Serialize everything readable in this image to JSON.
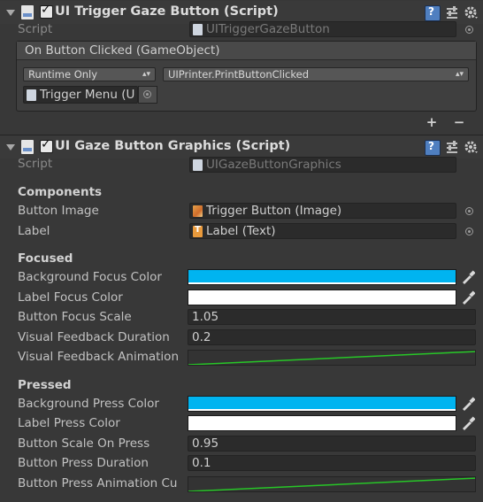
{
  "trigger_component": {
    "title": "UI Trigger Gaze Button (Script)",
    "script_label": "Script",
    "script_value": "UITriggerGazeButton",
    "event_header": "On Button Clicked (GameObject)",
    "runtime_option": "Runtime Only",
    "function_value": "UIPrinter.PrintButtonClicked",
    "target_object": "Trigger Menu (U",
    "add_label": "+",
    "remove_label": "−"
  },
  "graphics_component": {
    "title": "UI Gaze Button Graphics (Script)",
    "script_label": "Script",
    "script_value": "UIGazeButtonGraphics",
    "components_header": "Components",
    "button_image_label": "Button Image",
    "button_image_value": "Trigger Button (Image)",
    "label_label": "Label",
    "label_value": "Label (Text)",
    "focused_header": "Focused",
    "bg_focus_color_label": "Background Focus Color",
    "label_focus_color_label": "Label Focus Color",
    "button_focus_scale_label": "Button Focus Scale",
    "button_focus_scale_value": "1.05",
    "visual_feedback_duration_label": "Visual Feedback Duration",
    "visual_feedback_duration_value": "0.2",
    "visual_feedback_animation_label": "Visual Feedback Animation",
    "pressed_header": "Pressed",
    "bg_press_color_label": "Background Press Color",
    "label_press_color_label": "Label Press Color",
    "button_scale_on_press_label": "Button Scale On Press",
    "button_scale_on_press_value": "0.95",
    "button_press_duration_label": "Button Press Duration",
    "button_press_duration_value": "0.1",
    "button_press_animation_label": "Button Press Animation Cu"
  },
  "colors": {
    "focus_bg": "#00b4f0",
    "focus_label": "#ffffff",
    "press_bg": "#00b4f0",
    "press_label": "#ffffff",
    "curve": "#27c627"
  }
}
